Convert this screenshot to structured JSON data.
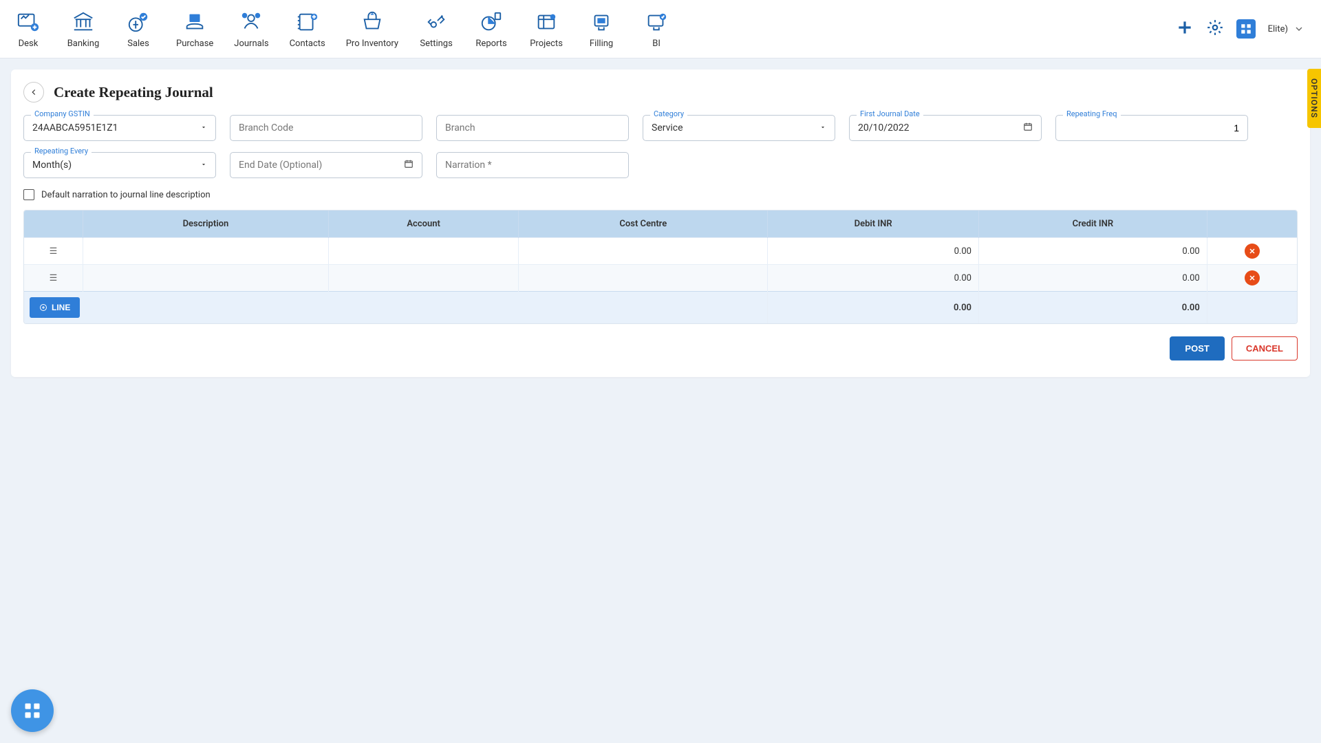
{
  "nav": {
    "items": [
      {
        "label": "Desk"
      },
      {
        "label": "Banking"
      },
      {
        "label": "Sales"
      },
      {
        "label": "Purchase"
      },
      {
        "label": "Journals"
      },
      {
        "label": "Contacts"
      },
      {
        "label": "Pro Inventory"
      },
      {
        "label": "Settings"
      },
      {
        "label": "Reports"
      },
      {
        "label": "Projects"
      },
      {
        "label": "Filling"
      },
      {
        "label": "BI"
      }
    ],
    "user_suffix": "Elite)"
  },
  "page": {
    "title": "Create Repeating Journal",
    "options_tab": "OPTIONS"
  },
  "form": {
    "gstin_label": "Company GSTIN",
    "gstin_value": "24AABCA5951E1Z1",
    "branch_code_placeholder": "Branch Code",
    "branch_placeholder": "Branch",
    "category_label": "Category",
    "category_value": "Service",
    "first_date_label": "First Journal Date",
    "first_date_value": "20/10/2022",
    "freq_label": "Repeating Freq",
    "freq_value": "1",
    "every_label": "Repeating Every",
    "every_value": "Month(s)",
    "end_date_placeholder": "End Date (Optional)",
    "narration_placeholder": "Narration *",
    "default_narration_checkbox": "Default narration to journal line description"
  },
  "table": {
    "headers": {
      "description": "Description",
      "account": "Account",
      "cost_centre": "Cost Centre",
      "debit": "Debit INR",
      "credit": "Credit INR"
    },
    "rows": [
      {
        "debit": "0.00",
        "credit": "0.00"
      },
      {
        "debit": "0.00",
        "credit": "0.00"
      }
    ],
    "totals": {
      "debit": "0.00",
      "credit": "0.00"
    },
    "line_btn": "LINE"
  },
  "actions": {
    "post": "POST",
    "cancel": "CANCEL"
  }
}
